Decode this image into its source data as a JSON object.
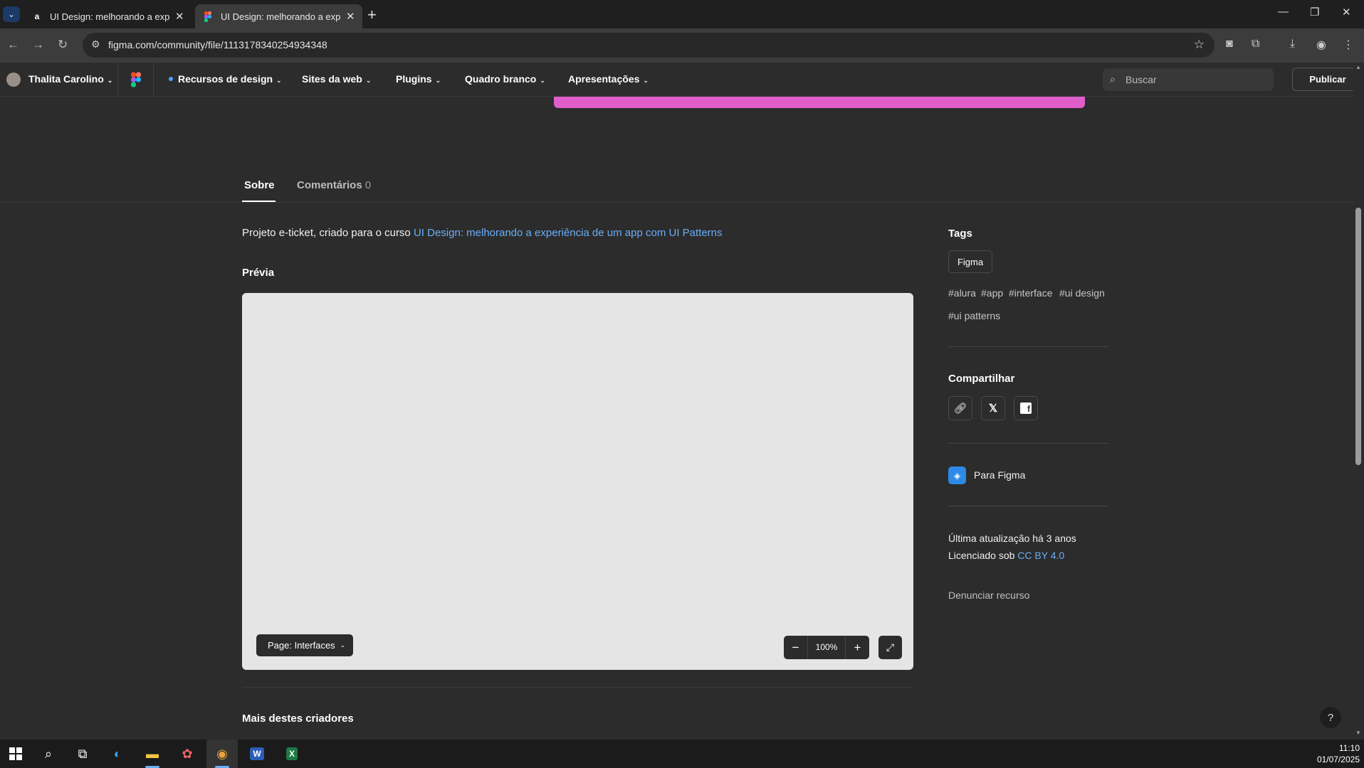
{
  "browser": {
    "tabs": [
      {
        "title": "UI Design: melhorando a experiência",
        "favicon": "a",
        "active": false
      },
      {
        "title": "UI Design: melhorando a experiência",
        "favicon": "figma",
        "active": true
      }
    ],
    "url": "figma.com/community/file/1113178340254934348"
  },
  "header": {
    "user_name": "Thalita Carolino",
    "nav": [
      {
        "label": "Recursos de design"
      },
      {
        "label": "Sites da web"
      },
      {
        "label": "Plugins"
      },
      {
        "label": "Quadro branco"
      },
      {
        "label": "Apresentações"
      }
    ],
    "search_placeholder": "Buscar",
    "publish_label": "Publicar"
  },
  "page_tabs": {
    "about": "Sobre",
    "comments": "Comentários",
    "comments_count": "0"
  },
  "description": {
    "prefix": "Projeto e-ticket, criado para o curso",
    "link": "UI Design: melhorando a experiência de um app com UI Patterns"
  },
  "preview": {
    "heading": "Prévia",
    "page_select": "Page: Interfaces",
    "zoom": "100%"
  },
  "more_heading": "Mais destes criadores",
  "sidebar": {
    "tags_heading": "Tags",
    "chip": "Figma",
    "tags": [
      "#alura",
      "#app",
      "#interface",
      "#ui design",
      "#ui patterns"
    ],
    "share_heading": "Compartilhar",
    "for_figma": "Para Figma",
    "last_update": "Última atualização há 3 anos",
    "license_prefix": "Licenciado sob",
    "license_link": "CC BY 4.0",
    "report": "Denunciar recurso"
  },
  "taskbar": {
    "time": "11:10",
    "date": "01/07/2025"
  },
  "colors": {
    "banner": "#e05ec9",
    "link": "#6aaef6",
    "background": "#2c2c2c"
  }
}
